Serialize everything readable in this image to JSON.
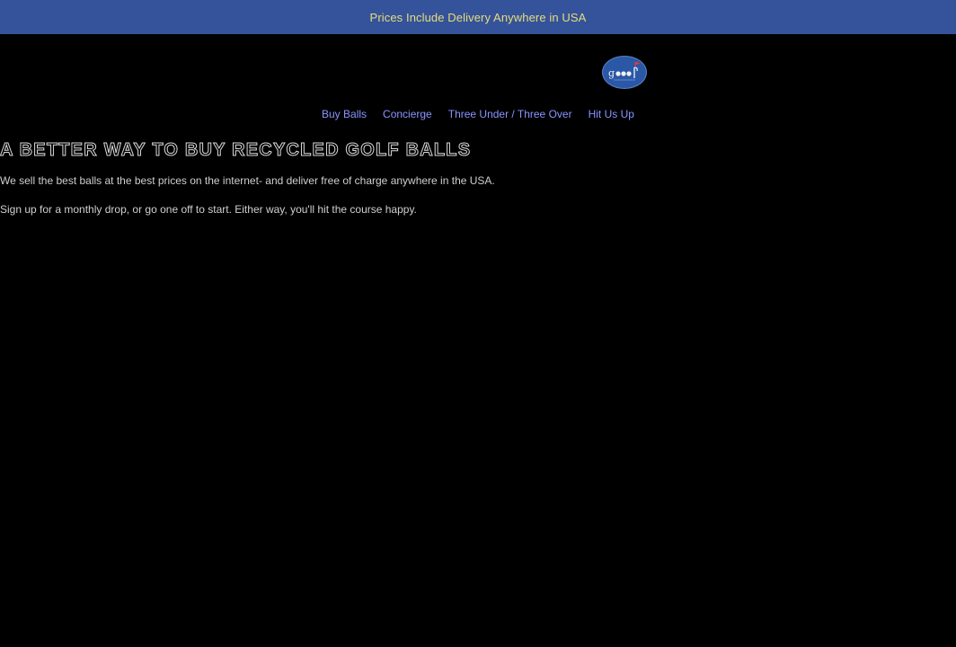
{
  "announcement": {
    "text": "Prices Include Delivery Anywhere in USA"
  },
  "logo": {
    "icon": "golf-balls-logo-icon",
    "color": "#2a57a6"
  },
  "nav": {
    "items": [
      {
        "label": "Buy Balls"
      },
      {
        "label": "Concierge"
      },
      {
        "label": "Three Under / Three Over"
      },
      {
        "label": "Hit Us Up"
      }
    ]
  },
  "hero": {
    "heading": "A BETTER WAY TO BUY RECYCLED GOLF BALLS",
    "line1": "We sell the best balls at the best prices on the internet- and deliver free of charge anywhere in the USA.",
    "line2": "Sign up for a monthly drop, or go one off to start. Either way, you'll hit the course happy."
  },
  "colors": {
    "announcement_bg": "#34539a",
    "announcement_text": "#e8dc7a",
    "nav_link": "#8a95ff",
    "page_bg": "#000000"
  }
}
